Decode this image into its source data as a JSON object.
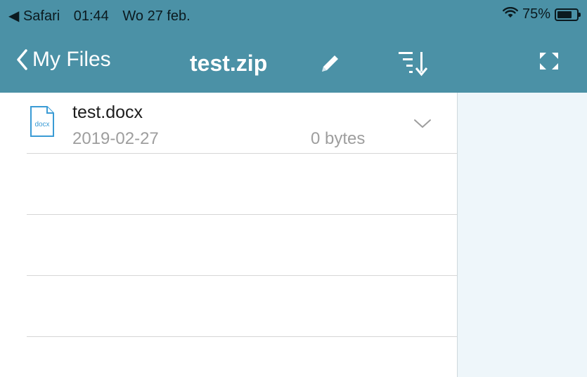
{
  "status_bar": {
    "back_app": "◀ Safari",
    "time": "01:44",
    "date": "Wo 27 feb.",
    "battery": "75%",
    "battery_level": 0.75
  },
  "nav": {
    "back_label": "My Files",
    "title": "test.zip"
  },
  "files": [
    {
      "name": "test.docx",
      "date": "2019-02-27",
      "size": "0 bytes",
      "icon_label": "docx"
    }
  ],
  "colors": {
    "header": "#4b91a6",
    "detail_bg": "#eef6fa"
  }
}
